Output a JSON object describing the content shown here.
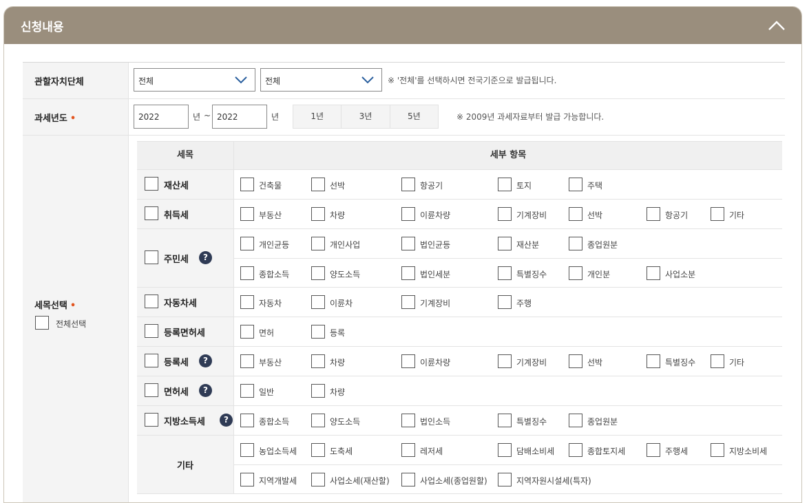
{
  "panel": {
    "title": "신청내용"
  },
  "region": {
    "label": "관할자치단체",
    "select1": "전체",
    "select2": "전체",
    "note": "※ '전체'를 선택하시면 전국기준으로 발급됩니다."
  },
  "year": {
    "label": "과세년도",
    "required_mark": "•",
    "from": "2022",
    "from_unit": "년",
    "tilde": "~",
    "to": "2022",
    "to_unit": "년",
    "quick": [
      "1년",
      "3년",
      "5년"
    ],
    "note": "※ 2009년 과세자료부터 발급 가능합니다."
  },
  "tax": {
    "label": "세목선택",
    "required_mark": "•",
    "select_all": "전체선택",
    "col_tax": "세목",
    "col_detail": "세부 항목",
    "rows": [
      {
        "name": "재산세",
        "help": false,
        "lines": [
          [
            "건축물",
            "선박",
            "항공기",
            "토지",
            "주택"
          ]
        ]
      },
      {
        "name": "취득세",
        "help": false,
        "lines": [
          [
            "부동산",
            "차량",
            "이륜차량",
            "기계장비",
            "선박",
            "항공기",
            "기타"
          ]
        ]
      },
      {
        "name": "주민세",
        "help": true,
        "lines": [
          [
            "개인균등",
            "개인사업",
            "법인균등",
            "재산분",
            "종업원분"
          ],
          [
            "종합소득",
            "양도소득",
            "법인세분",
            "특별징수",
            "개인분",
            "사업소분"
          ]
        ]
      },
      {
        "name": "자동차세",
        "help": false,
        "lines": [
          [
            "자동차",
            "이륜차",
            "기계장비",
            "주행"
          ]
        ]
      },
      {
        "name": "등록면허세",
        "help": false,
        "lines": [
          [
            "면허",
            "등록"
          ]
        ]
      },
      {
        "name": "등록세",
        "help": true,
        "lines": [
          [
            "부동산",
            "차량",
            "이륜차량",
            "기계장비",
            "선박",
            "특별징수",
            "기타"
          ]
        ]
      },
      {
        "name": "면허세",
        "help": true,
        "lines": [
          [
            "일반",
            "차량"
          ]
        ]
      },
      {
        "name": "지방소득세",
        "help": true,
        "lines": [
          [
            "종합소득",
            "양도소득",
            "법인소득",
            "특별징수",
            "종업원분"
          ]
        ]
      },
      {
        "name": "기타",
        "help": false,
        "nocheck": true,
        "lines": [
          [
            "농업소득세",
            "도축세",
            "레저세",
            "담배소비세",
            "종합토지세",
            "주행세",
            "지방소비세"
          ],
          [
            "지역개발세",
            "사업소세(재산할)",
            "사업소세(종업원할)",
            "지역자원시설세(특자)"
          ]
        ]
      }
    ]
  },
  "help_glyph": "?",
  "icons": {
    "collapse": "chevron-up-icon",
    "dropdown": "chevron-down-icon",
    "help": "question-icon"
  },
  "colors": {
    "header": "#9a8e7d",
    "required": "#e2541e",
    "help_badge": "#2f3b55"
  }
}
